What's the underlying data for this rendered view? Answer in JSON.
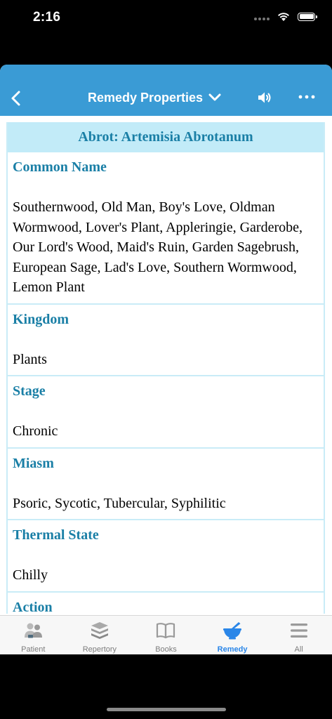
{
  "status_bar": {
    "time": "2:16"
  },
  "navbar": {
    "title": "Remedy Properties",
    "back_icon": "chevron-left-icon",
    "title_menu_icon": "chevron-down-icon",
    "speaker_icon": "speaker-icon",
    "more_icon": "more-icon"
  },
  "remedy": {
    "header": "Abrot: Artemisia Abrotanum",
    "sections": [
      {
        "title": "Common Name",
        "value": "Southernwood, Old Man, Boy's Love, Oldman Wormwood, Lover's Plant, Appleringie, Garderobe, Our Lord's Wood, Maid's Ruin, Garden Sagebrush, European Sage, Lad's Love, Southern Wormwood, Lemon Plant"
      },
      {
        "title": "Kingdom",
        "value": "Plants"
      },
      {
        "title": "Stage",
        "value": "Chronic"
      },
      {
        "title": "Miasm",
        "value": "Psoric, Sycotic, Tubercular, Syphilitic"
      },
      {
        "title": "Thermal State",
        "value": "Chilly"
      },
      {
        "title": "Action",
        "value": ""
      }
    ]
  },
  "tabs": [
    {
      "label": "Patient",
      "icon": "patient-icon",
      "active": false
    },
    {
      "label": "Repertory",
      "icon": "repertory-icon",
      "active": false
    },
    {
      "label": "Books",
      "icon": "books-icon",
      "active": false
    },
    {
      "label": "Remedy",
      "icon": "remedy-icon",
      "active": true
    },
    {
      "label": "All",
      "icon": "menu-icon",
      "active": false
    }
  ],
  "colors": {
    "navbar": "#3a9bd5",
    "section_title": "#1a7fa6",
    "header_bg": "#c2ebf8",
    "active_tab": "#2a86e8",
    "inactive_tab": "#7d7d7d"
  }
}
